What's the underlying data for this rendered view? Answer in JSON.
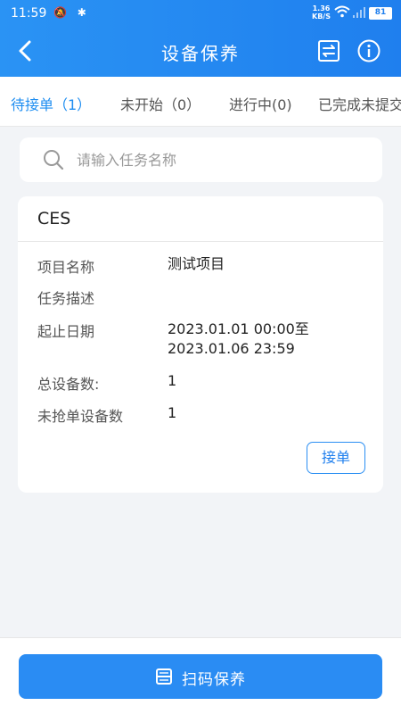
{
  "status_bar": {
    "time": "11:59",
    "icons_left": "🔕 ✱",
    "speed_value": "1.36",
    "speed_unit": "KB/S",
    "battery": "81"
  },
  "header": {
    "title": "设备保养"
  },
  "tabs": [
    {
      "label": "待接单（1）",
      "active": true
    },
    {
      "label": "未开始（0）",
      "active": false
    },
    {
      "label": "进行中(0)",
      "active": false
    },
    {
      "label": "已完成未提交",
      "active": false
    }
  ],
  "search": {
    "placeholder": "请输入任务名称",
    "value": ""
  },
  "task_card": {
    "title": "CES",
    "rows": [
      {
        "label": "项目名称",
        "value": "测试项目"
      },
      {
        "label": "任务描述",
        "value": ""
      },
      {
        "label": "起止日期",
        "value_line1": "2023.01.01 00:00至",
        "value_line2": "2023.01.06 23:59"
      },
      {
        "label": "总设备数:",
        "value": "1"
      },
      {
        "label": "未抢单设备数",
        "value": "1"
      }
    ],
    "accept_label": "接单"
  },
  "bottom": {
    "scan_label": "扫码保养"
  },
  "colors": {
    "primary": "#1f7fee",
    "active_tab": "#1f8ef1",
    "background": "#f2f4f7"
  }
}
